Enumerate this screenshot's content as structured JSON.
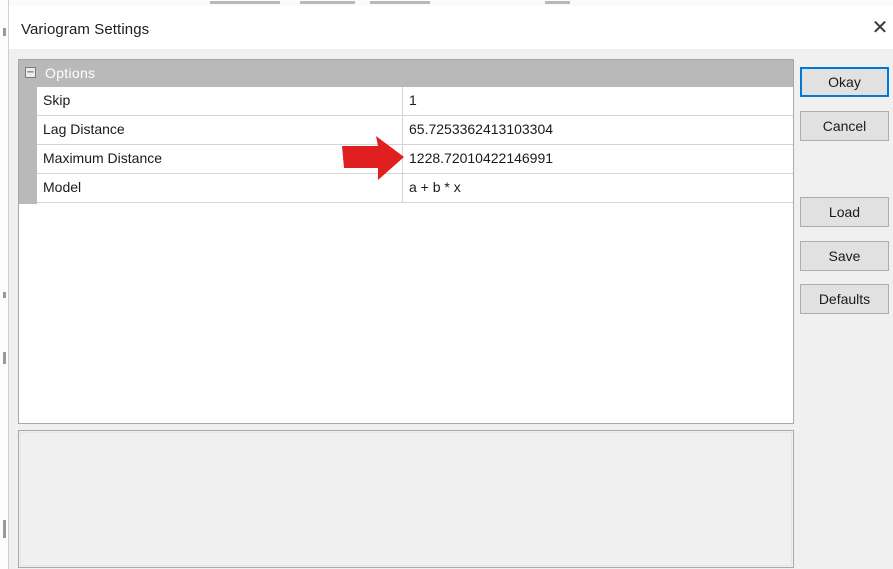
{
  "window": {
    "title": "Variogram Settings",
    "close_glyph": "✕"
  },
  "property_grid": {
    "category": {
      "toggle_glyph": "⊟",
      "label": "Options"
    },
    "rows": [
      {
        "name": "Skip",
        "value": "1"
      },
      {
        "name": "Lag Distance",
        "value": "65.7253362413103304"
      },
      {
        "name": "Maximum Distance",
        "value": "1228.72010422146991"
      },
      {
        "name": "Model",
        "value": "a + b * x"
      }
    ]
  },
  "buttons": {
    "okay": "Okay",
    "cancel": "Cancel",
    "load": "Load",
    "save": "Save",
    "defaults": "Defaults"
  },
  "annotation": {
    "icon": "red-arrow-icon",
    "color": "#e02020"
  }
}
